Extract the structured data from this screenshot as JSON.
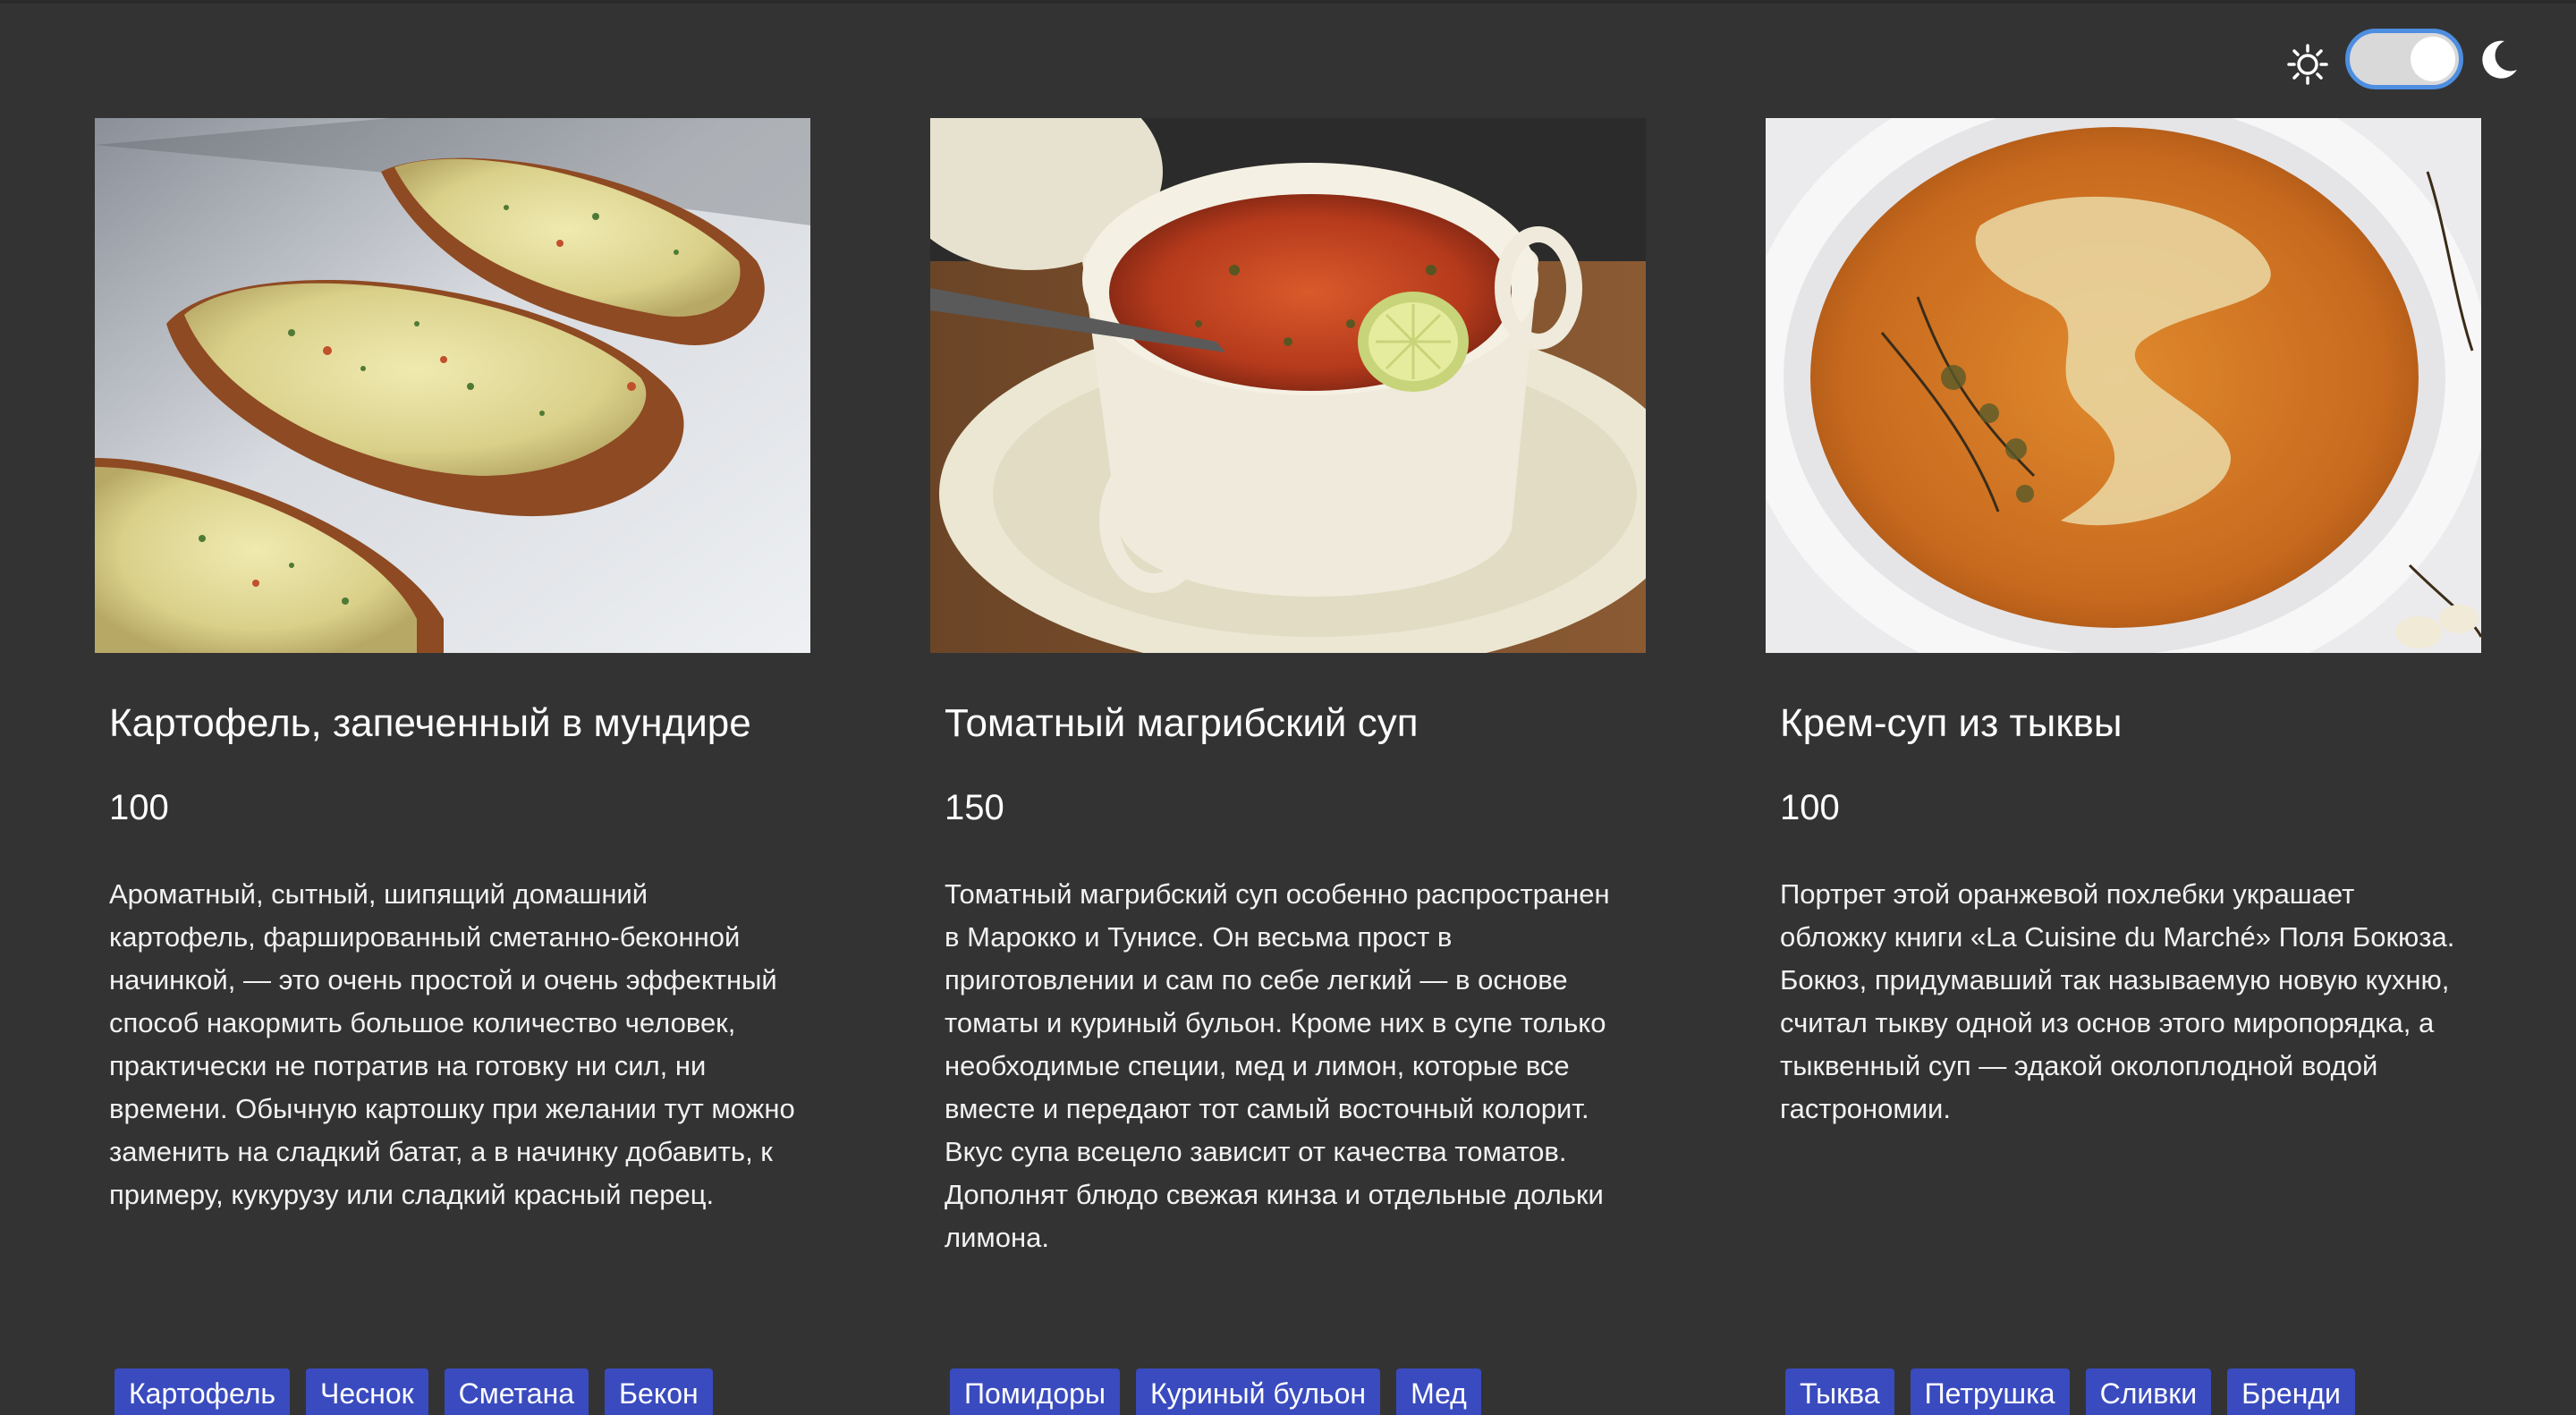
{
  "theme": {
    "mode": "dark",
    "toggle_color": "#4d8ee0"
  },
  "cards": [
    {
      "title": "Картофель, запеченный в мундире",
      "price": "100",
      "description": "Ароматный, сытный, шипящий домашний картофель, фаршированный сметанно-беконной начинкой, — это очень простой и очень эффектный способ накормить большое количество человек, практически не потратив на готовку ни сил, ни времени. Обычную картошку при желании тут можно заменить на сладкий батат, а в начинку добавить, к примеру, кукурузу или сладкий красный перец.",
      "tags": [
        "Картофель",
        "Чеснок",
        "Сметана",
        "Бекон"
      ]
    },
    {
      "title": "Томатный магрибский суп",
      "price": "150",
      "description": "Томатный магрибский суп особенно распространен в Марокко и Тунисе. Он весьма прост в приготовлении и сам по себе легкий — в основе томаты и куриный бульон. Кроме них в супе только необходимые специи, мед и лимон, которые все вместе и передают тот самый восточный колорит. Вкус супа всецело зависит от качества томатов. Дополнят блюдо свежая кинза и отдельные дольки лимона.",
      "tags": [
        "Помидоры",
        "Куриный бульон",
        "Мед"
      ]
    },
    {
      "title": "Крем-суп из тыквы",
      "price": "100",
      "description": "Портрет этой оранжевой похлебки украшает обложку книги «La Cuisine du Marché» Поля Бокюза. Бокюз, придумавший так называемую новую кухню, считал тыкву одной из основ этого миропорядка, а тыквенный суп — эдакой околоплодной водой гастрономии.",
      "tags": [
        "Тыква",
        "Петрушка",
        "Сливки",
        "Бренди"
      ]
    }
  ]
}
